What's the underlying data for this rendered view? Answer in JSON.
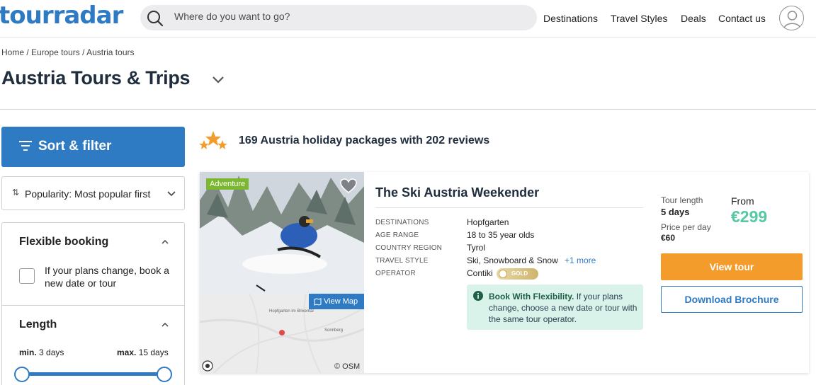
{
  "header": {
    "logo_text": "tourradar",
    "logo_mark": "™",
    "search": {
      "placeholder": "Where do you want to go?",
      "icon": "search-icon"
    },
    "nav": [
      {
        "label": "Destinations"
      },
      {
        "label": "Travel Styles"
      },
      {
        "label": "Deals"
      },
      {
        "label": "Contact us"
      }
    ],
    "account_icon": "user-icon"
  },
  "breadcrumb": {
    "home": "Home",
    "region": "Europe tours",
    "current": "Austria tours",
    "separator": "/"
  },
  "page": {
    "title": "Austria Tours & Trips"
  },
  "sidebar": {
    "sort_filter_label": "Sort & filter",
    "sort_select": {
      "selected": "Popularity: Most popular first"
    },
    "flexible_booking": {
      "title": "Flexible booking",
      "option_label": "If your plans change, book a new date or tour",
      "checked": false
    },
    "length": {
      "title": "Length",
      "min_label": "min.",
      "min_value": "3 days",
      "max_label": "max.",
      "max_value": "15 days"
    }
  },
  "results": {
    "summary": "169 Austria holiday packages with 202 reviews"
  },
  "tour": {
    "badge": "Adventure",
    "title": "The Ski Austria Weekender",
    "view_map": "View Map",
    "map_credit": "© OSM",
    "map_labels": {
      "town": "Hopfgarten im Brixental",
      "nearby": "Sonnberg"
    },
    "details": [
      {
        "label": "DESTINATIONS",
        "value": "Hopfgarten"
      },
      {
        "label": "AGE RANGE",
        "value": "18 to 35 year olds"
      },
      {
        "label": "COUNTRY REGION",
        "value": "Tyrol"
      },
      {
        "label": "TRAVEL STYLE",
        "value": "Ski, Snowboard & Snow"
      },
      {
        "label": "OPERATOR",
        "value": "Contiki"
      }
    ],
    "more_styles": "+1 more",
    "operator_badge": "GOLD",
    "flexibility": {
      "title": "Book With Flexibility.",
      "text": "If your plans change, choose a new date or tour with the same tour operator."
    },
    "tour_length_label": "Tour length",
    "tour_length": "5 days",
    "price_per_day_label": "Price per day",
    "price_per_day": "€60",
    "from_label": "From",
    "price": "€299",
    "view_tour": "View tour",
    "download_brochure": "Download Brochure"
  },
  "colors": {
    "brand_blue": "#2e7bc3",
    "accent_orange": "#f39c2b",
    "price_green": "#57c8a5",
    "adventure_green": "#7cb82f"
  }
}
